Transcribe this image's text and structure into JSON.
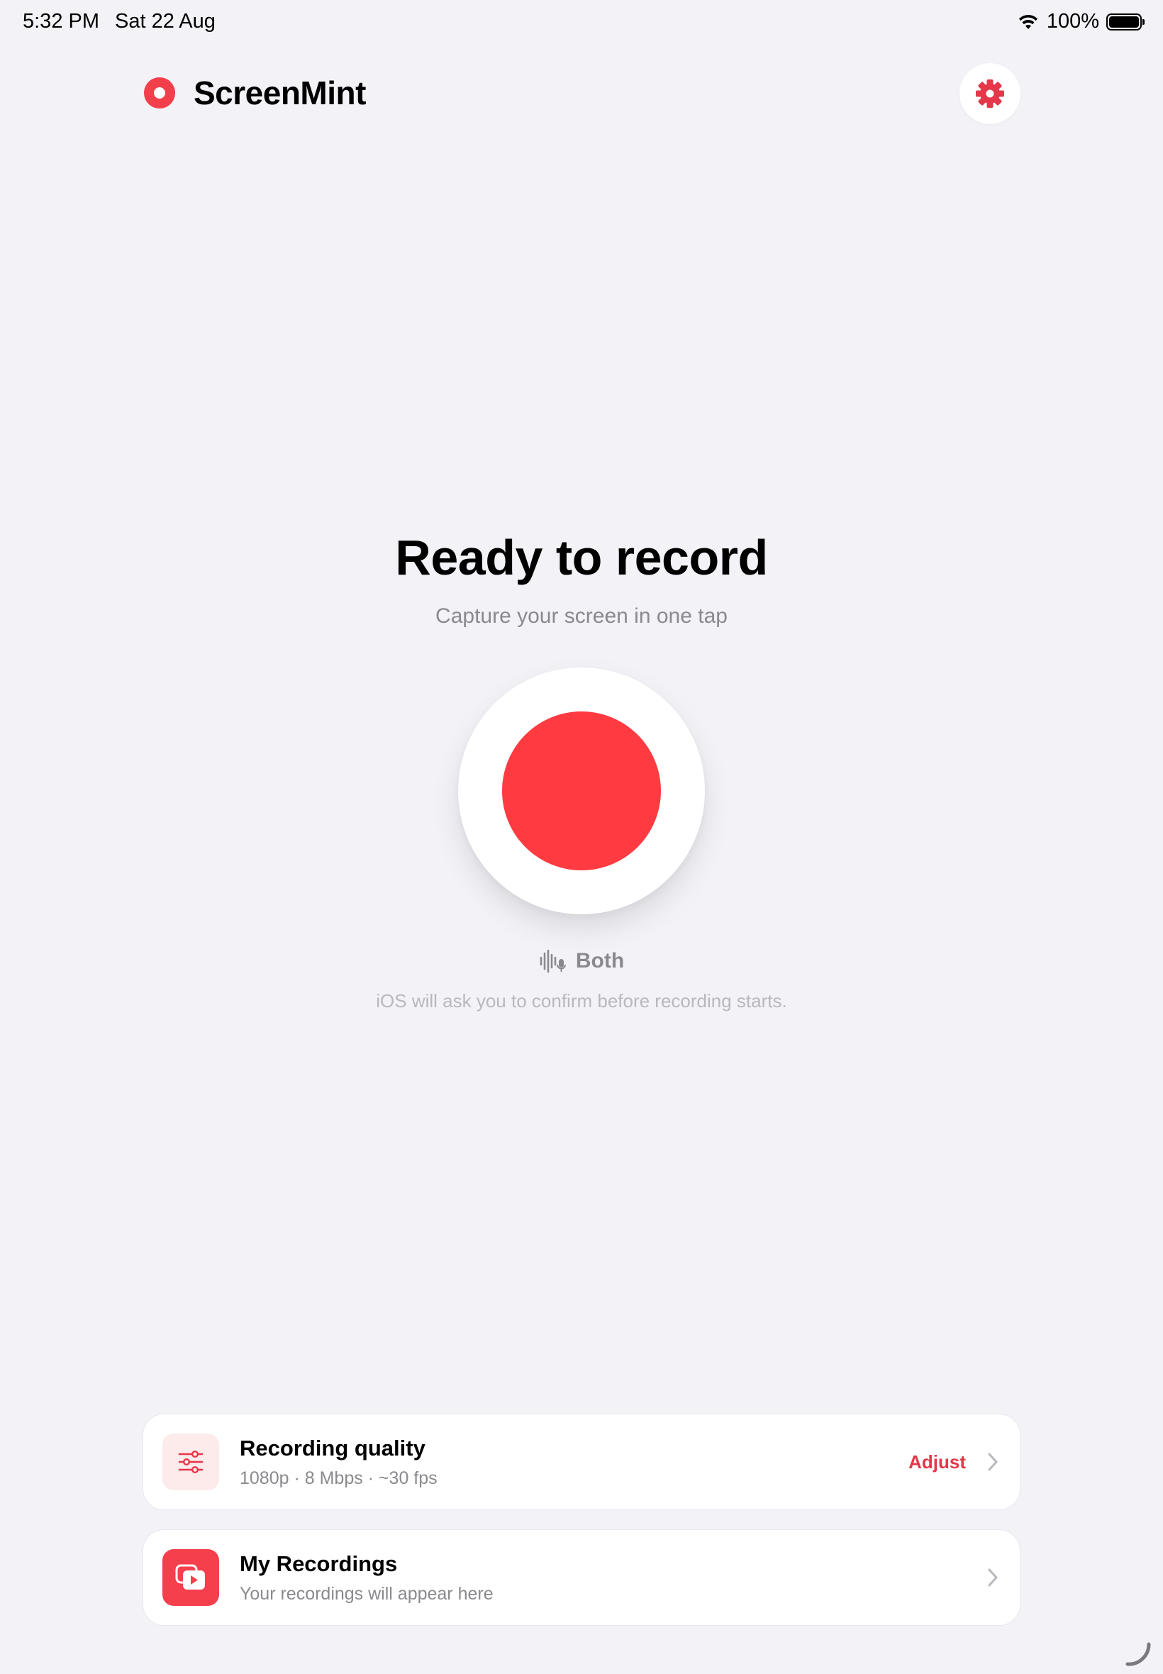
{
  "status_bar": {
    "time": "5:32 PM",
    "date": "Sat 22 Aug",
    "battery": "100%",
    "battery_level": 1.0
  },
  "header": {
    "app_name": "ScreenMint",
    "logo_icon": "record-dot-icon",
    "settings_icon": "gear-icon"
  },
  "hero": {
    "title": "Ready to record",
    "subtitle": "Capture your screen in one tap",
    "record_button_icon": "record-button-icon",
    "audio_mode_icon": "waveform-mic-icon",
    "audio_mode": "Both",
    "hint": "iOS will ask you to confirm before recording starts."
  },
  "cards": {
    "quality": {
      "icon": "sliders-icon",
      "title": "Recording quality",
      "subtitle": "1080p · 8 Mbps · ~30 fps",
      "action": "Adjust"
    },
    "recordings": {
      "icon": "play-stack-icon",
      "title": "My Recordings",
      "subtitle": "Your recordings will appear here"
    }
  },
  "colors": {
    "accent": "#FF3B41",
    "accent_text": "#E5374A",
    "background": "#F2F2F7"
  }
}
